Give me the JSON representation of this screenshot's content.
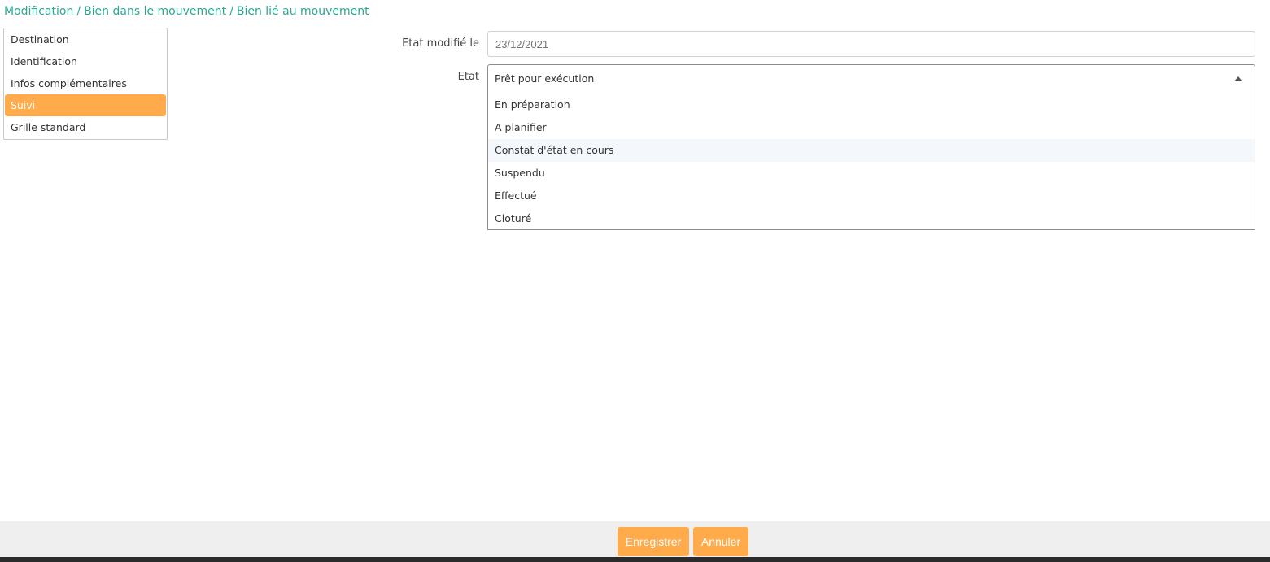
{
  "breadcrumb": {
    "items": [
      "Modification",
      "Bien dans le mouvement",
      "Bien lié au mouvement"
    ],
    "separator": "/"
  },
  "sidebar": {
    "items": [
      {
        "label": "Destination",
        "active": false
      },
      {
        "label": "Identification",
        "active": false
      },
      {
        "label": "Infos complémentaires",
        "active": false
      },
      {
        "label": "Suivi",
        "active": true
      },
      {
        "label": "Grille standard",
        "active": false
      }
    ]
  },
  "form": {
    "modified_label": "Etat modifié le",
    "modified_placeholder": "23/12/2021",
    "state_label": "Etat",
    "state_value": "Prêt pour exécution",
    "state_options": [
      "En préparation",
      "A planifier",
      "Constat d'état en cours",
      "Suspendu",
      "Effectué",
      "Cloturé"
    ],
    "hovered_option": "Constat d'état en cours"
  },
  "footer": {
    "save_label": "Enregistrer",
    "cancel_label": "Annuler"
  },
  "colors": {
    "accent": "#ffaa4b",
    "breadcrumb": "#2aa792",
    "option_hover": "#f4f8fc"
  }
}
